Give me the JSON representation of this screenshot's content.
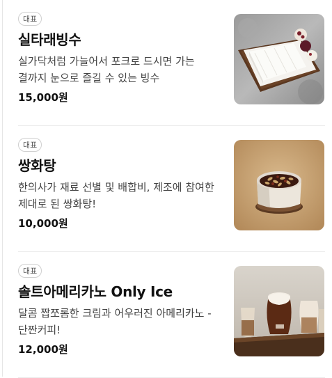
{
  "menu": {
    "items": [
      {
        "badge": "대표",
        "name": "실타래빙수",
        "description": "실가닥처럼 가늘어서 포크로 드시면 가는 결까지 눈으로 즐길 수 있는 빙수",
        "price": "15,000원",
        "image": "shaved-ice-bingsu-photo"
      },
      {
        "badge": "대표",
        "name": "쌍화탕",
        "description": "한의사가 재료 선별 및 배합비, 제조에 참여한 제대로 된 쌍화탕!",
        "price": "10,000원",
        "image": "ssanghwa-tea-cup-photo"
      },
      {
        "badge": "대표",
        "name": "솔트아메리카노 Only Ice",
        "description": "달콤 짭쪼롬한 크림과 어우러진 아메리카노 - 단짠커피!",
        "price": "12,000원",
        "image": "iced-coffee-glasses-photo"
      }
    ]
  }
}
